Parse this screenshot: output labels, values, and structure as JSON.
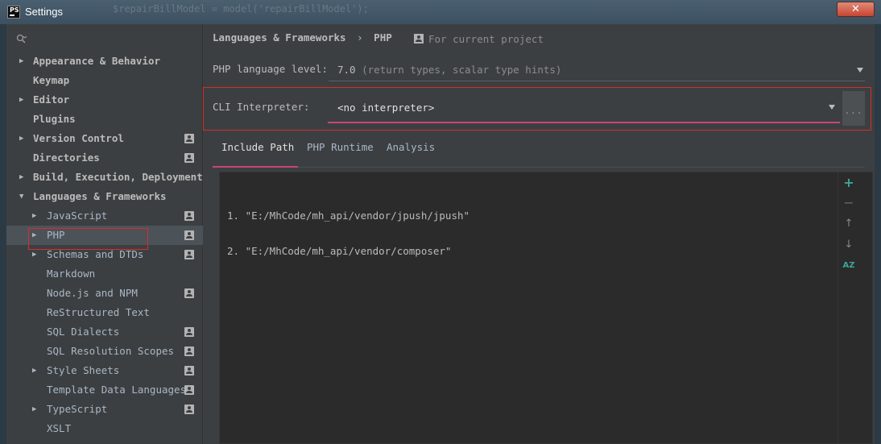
{
  "window": {
    "title": "Settings",
    "background_code": "$repairBillModel = model('repairBillModel');",
    "close_glyph": "✕"
  },
  "sidebar": {
    "search_placeholder": "",
    "items": [
      {
        "label": "Appearance & Behavior",
        "expandable": true,
        "expanded": false,
        "bold": true,
        "project_badge": false
      },
      {
        "label": "Keymap",
        "expandable": false,
        "bold": true,
        "project_badge": false
      },
      {
        "label": "Editor",
        "expandable": true,
        "expanded": false,
        "bold": true,
        "project_badge": false
      },
      {
        "label": "Plugins",
        "expandable": false,
        "bold": true,
        "project_badge": false
      },
      {
        "label": "Version Control",
        "expandable": true,
        "expanded": false,
        "bold": true,
        "project_badge": true
      },
      {
        "label": "Directories",
        "expandable": false,
        "bold": true,
        "project_badge": true
      },
      {
        "label": "Build, Execution, Deployment",
        "expandable": true,
        "expanded": false,
        "bold": true,
        "project_badge": false
      },
      {
        "label": "Languages & Frameworks",
        "expandable": true,
        "expanded": true,
        "bold": true,
        "project_badge": false
      },
      {
        "label": "JavaScript",
        "expandable": true,
        "expanded": false,
        "bold": false,
        "project_badge": true
      },
      {
        "label": "PHP",
        "expandable": true,
        "expanded": false,
        "bold": false,
        "project_badge": true,
        "selected": true
      },
      {
        "label": "Schemas and DTDs",
        "expandable": true,
        "expanded": false,
        "bold": false,
        "project_badge": true
      },
      {
        "label": "Markdown",
        "expandable": false,
        "bold": false,
        "project_badge": false
      },
      {
        "label": "Node.js and NPM",
        "expandable": false,
        "bold": false,
        "project_badge": true
      },
      {
        "label": "ReStructured Text",
        "expandable": false,
        "bold": false,
        "project_badge": false
      },
      {
        "label": "SQL Dialects",
        "expandable": false,
        "bold": false,
        "project_badge": true
      },
      {
        "label": "SQL Resolution Scopes",
        "expandable": false,
        "bold": false,
        "project_badge": true
      },
      {
        "label": "Style Sheets",
        "expandable": true,
        "expanded": false,
        "bold": false,
        "project_badge": true
      },
      {
        "label": "Template Data Languages",
        "expandable": false,
        "bold": false,
        "project_badge": true
      },
      {
        "label": "TypeScript",
        "expandable": true,
        "expanded": false,
        "bold": false,
        "project_badge": true
      },
      {
        "label": "XSLT",
        "expandable": false,
        "bold": false,
        "project_badge": false
      }
    ]
  },
  "header": {
    "breadcrumb_parent": "Languages & Frameworks",
    "breadcrumb_separator": "›",
    "breadcrumb_current": "PHP",
    "scope_label": "For current project"
  },
  "php_language_level": {
    "label": "PHP language level:",
    "value": "7.0",
    "hint": "(return types, scalar type hints)"
  },
  "cli_interpreter": {
    "label": "CLI Interpreter:",
    "value": "<no interpreter>",
    "more_button": "..."
  },
  "tabs": [
    {
      "label": "Include Path",
      "active": true
    },
    {
      "label": "PHP Runtime",
      "active": false
    },
    {
      "label": "Analysis",
      "active": false
    }
  ],
  "include_paths": [
    "1. \"E:/MhCode/mh_api/vendor/jpush/jpush\"",
    "2. \"E:/MhCode/mh_api/vendor/composer\""
  ],
  "toolbar": {
    "add": "+",
    "remove": "−",
    "move_up": "↑",
    "move_down": "↓",
    "sort": "AZ"
  },
  "colors": {
    "accent": "#c94577",
    "highlight_border": "#d62d2d",
    "toolbar_green": "#3ea598"
  }
}
